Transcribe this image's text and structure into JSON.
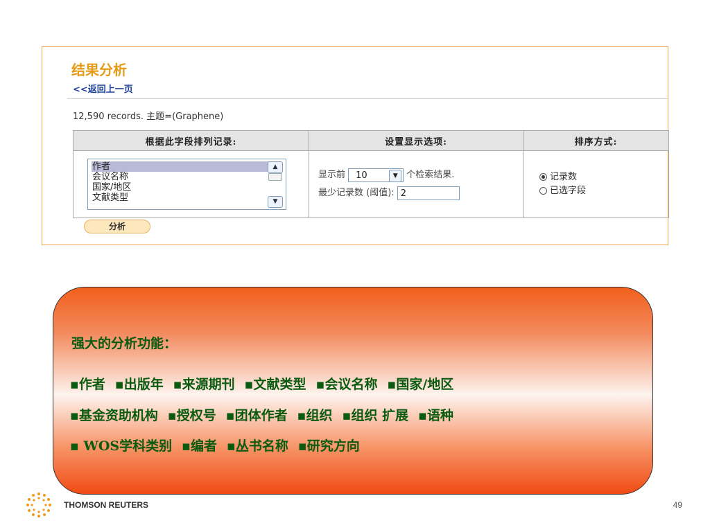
{
  "panel": {
    "title": "结果分析",
    "back_link": "<<返回上一页",
    "records": "12,590 records. 主题=(Graphene)",
    "columns": [
      "根据此字段排列记录:",
      "设置显示选项:",
      "排序方式:"
    ],
    "field_list": [
      "作者",
      "会议名称",
      "国家/地区",
      "文献类型"
    ],
    "selected_field": "作者",
    "display_prefix": "显示前",
    "display_count": "10",
    "display_suffix": "个检索结果.",
    "threshold_label": "最少记录数 (阈值):",
    "threshold_value": "2",
    "sort_options": [
      "记录数",
      "已选字段"
    ],
    "sort_selected": "记录数",
    "analyze_button": "分析"
  },
  "callout": {
    "heading": "强大的分析功能：",
    "line1": [
      "▪作者",
      "▪出版年",
      "▪来源期刊",
      "▪文献类型",
      "▪会议名称",
      "▪国家/地区"
    ],
    "line2": [
      "▪基金资助机构",
      "▪授权号",
      "▪团体作者",
      "▪组织",
      "▪组织 扩展",
      "▪语种"
    ],
    "line3": [
      "▪ WOS学科类别",
      "▪编者",
      "▪丛书名称",
      "▪研究方向"
    ]
  },
  "footer": {
    "brand": "THOMSON REUTERS",
    "page": "49"
  },
  "icons": {
    "logo": "thomson-reuters-logo-icon",
    "up": "scroll-up-icon",
    "down": "scroll-down-icon",
    "select_arrow": "chevron-down-icon"
  },
  "colors": {
    "title": "#e49b19",
    "link": "#1d3f9a",
    "callout_text": "#0a5a10",
    "callout_top": "#f25f1b"
  }
}
